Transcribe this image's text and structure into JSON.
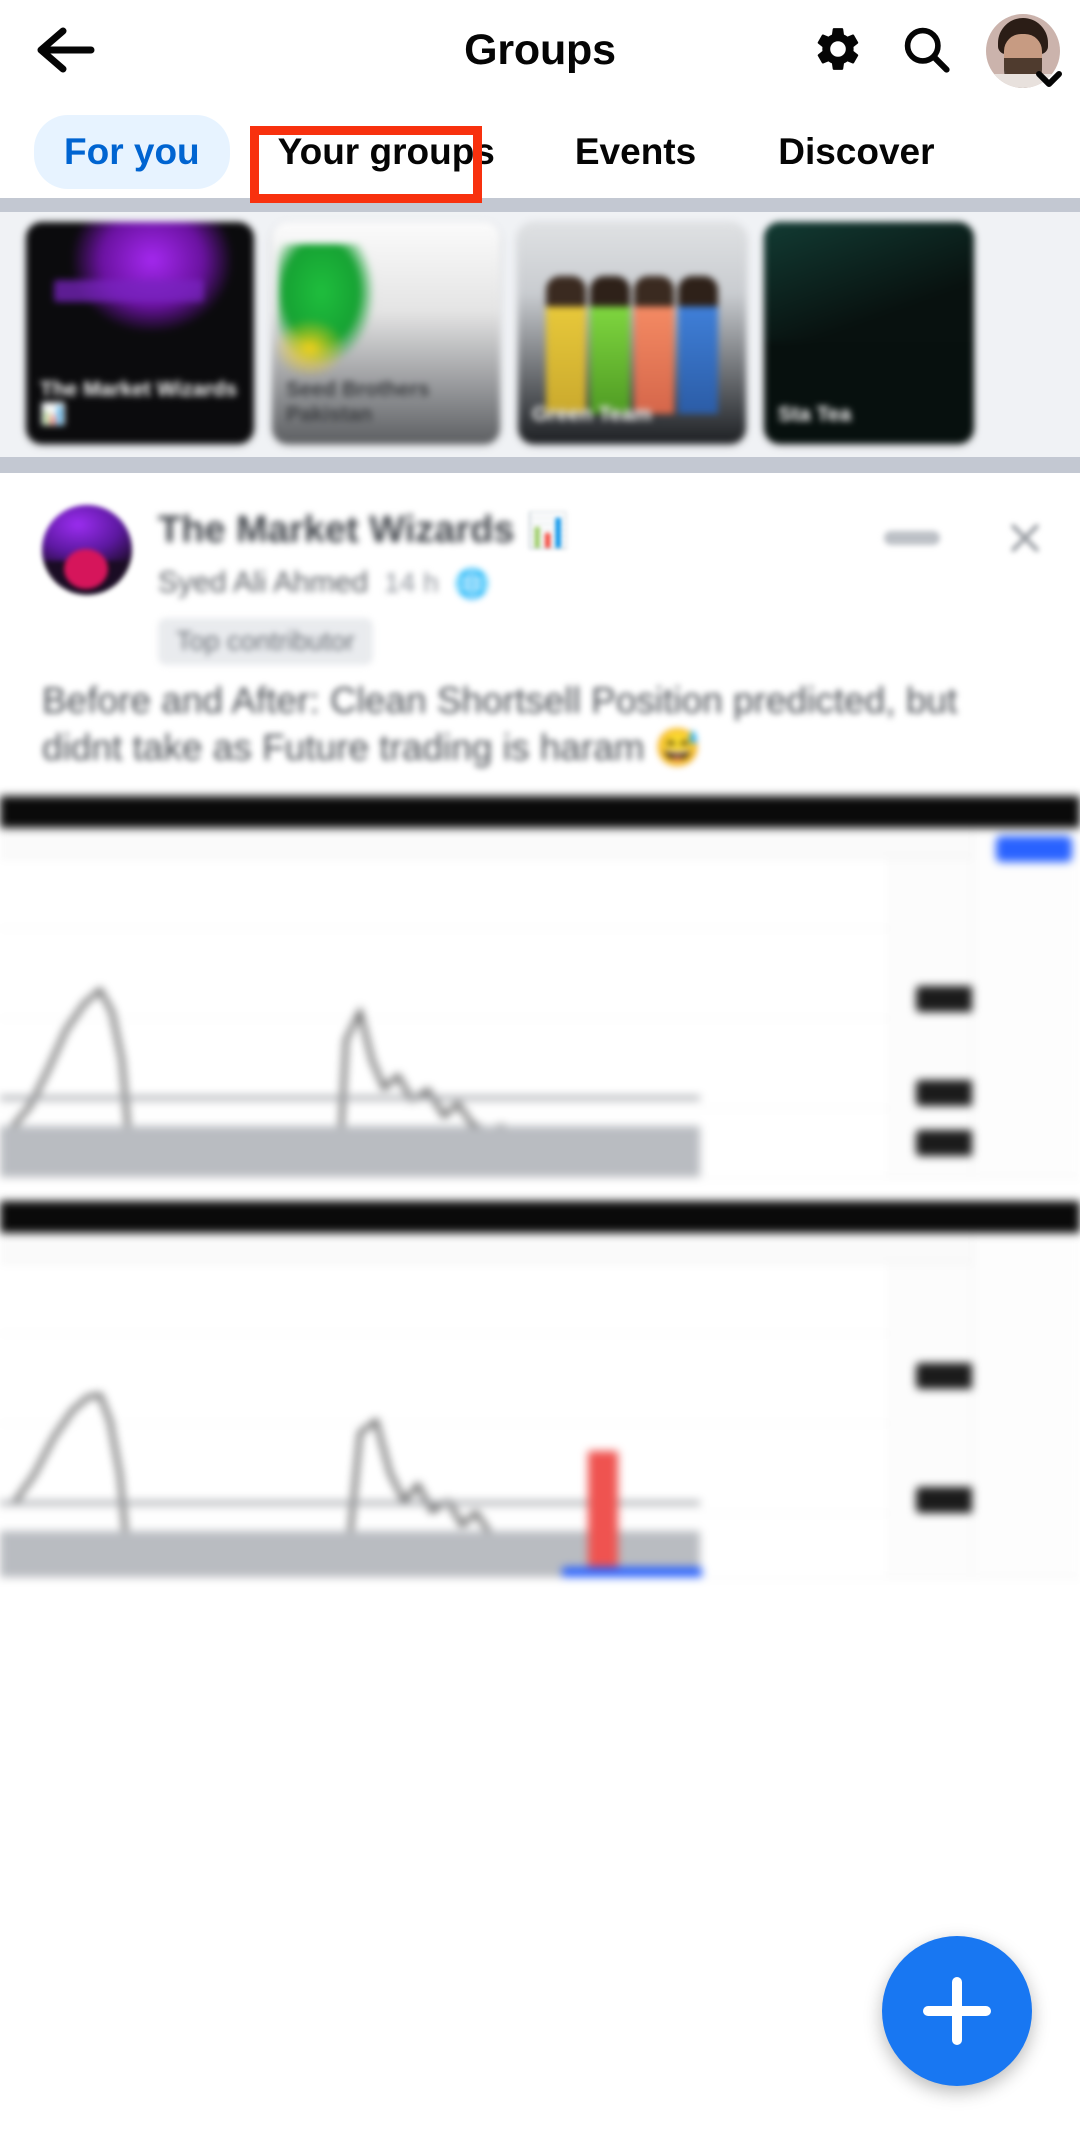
{
  "appbar": {
    "title": "Groups",
    "back_icon": "arrow-left-icon",
    "settings_icon": "gear-icon",
    "search_icon": "search-icon",
    "avatar_name": "profile-avatar",
    "avatar_chevron": "chevron-down-icon"
  },
  "tabs": [
    {
      "label": "For you",
      "active": true
    },
    {
      "label": "Your groups",
      "active": false,
      "highlighted": true
    },
    {
      "label": "Events",
      "active": false
    },
    {
      "label": "Discover",
      "active": false
    }
  ],
  "highlight": {
    "target_tab": "Your groups",
    "color": "#f8310e"
  },
  "carousel": [
    {
      "caption": "The Market\nWizards 📊"
    },
    {
      "caption": "Seed Brothers\nPakistan"
    },
    {
      "caption": "Green Team"
    },
    {
      "caption": "Sta\nTea"
    }
  ],
  "post": {
    "group_name": "The Market Wizards",
    "group_emoji": "📊",
    "author": "Syed Ali Ahmed",
    "timestamp": "14 h",
    "audience_icon": "globe-icon",
    "badge": "Top contributor",
    "more_icon": "more-options-icon",
    "close_icon": "close-icon",
    "body": "Before and After: Clean Shortsell Position predicted, but didnt take as Future trading is haram 😅",
    "attachments": [
      {
        "name": "tradingview-chart-before"
      },
      {
        "name": "tradingview-chart-after"
      }
    ]
  },
  "fab": {
    "label": "+",
    "icon": "plus-icon",
    "color": "#1877f2"
  },
  "colors": {
    "accent_blue": "#1877f2",
    "tab_active_bg": "#e7f3ff",
    "tab_active_text": "#0064d1",
    "highlight_red": "#f8310e",
    "separator": "#c3c8d2"
  }
}
